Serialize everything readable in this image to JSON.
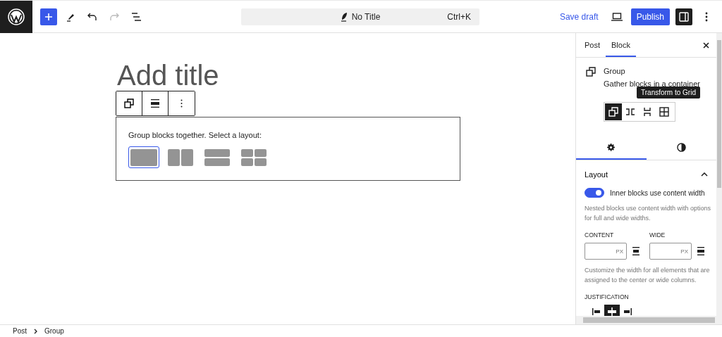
{
  "topbar": {
    "document_title": "No Title",
    "shortcut": "Ctrl+K",
    "save_draft": "Save draft",
    "publish": "Publish",
    "sidebar_open": true
  },
  "editor": {
    "title_placeholder": "Add title",
    "instructions": "Group blocks together. Select a layout:",
    "layouts": [
      {
        "kind": "group",
        "selected": true
      },
      {
        "kind": "row",
        "selected": false
      },
      {
        "kind": "stack",
        "selected": false
      },
      {
        "kind": "grid",
        "selected": false
      }
    ]
  },
  "sidebar": {
    "tabs": [
      {
        "label": "Post",
        "selected": false
      },
      {
        "label": "Block",
        "selected": true
      }
    ],
    "block": {
      "title": "Group",
      "description": "Gather blocks in a container"
    },
    "tooltip": "Transform to Grid",
    "variations": [
      {
        "kind": "group",
        "selected": true
      },
      {
        "kind": "row",
        "selected": false
      },
      {
        "kind": "stack",
        "selected": false
      },
      {
        "kind": "grid",
        "selected": false
      }
    ],
    "style_tabs": [
      {
        "kind": "settings",
        "selected": true
      },
      {
        "kind": "styles",
        "selected": false
      }
    ],
    "layout": {
      "title": "Layout",
      "expanded": true,
      "toggle": {
        "label": "Inner blocks use content width",
        "on": true
      },
      "help": "Nested blocks use content width with options for full and wide widths.",
      "fields": [
        {
          "label": "CONTENT",
          "unit": "PX"
        },
        {
          "label": "WIDE",
          "unit": "PX"
        }
      ],
      "fields_help": "Customize the width for all elements that are assigned to the center or wide columns.",
      "justification_label": "JUSTIFICATION",
      "justification": [
        {
          "kind": "left",
          "selected": false
        },
        {
          "kind": "center",
          "selected": true
        },
        {
          "kind": "right",
          "selected": false
        }
      ]
    }
  },
  "breadcrumbs": [
    "Post",
    "Group"
  ]
}
